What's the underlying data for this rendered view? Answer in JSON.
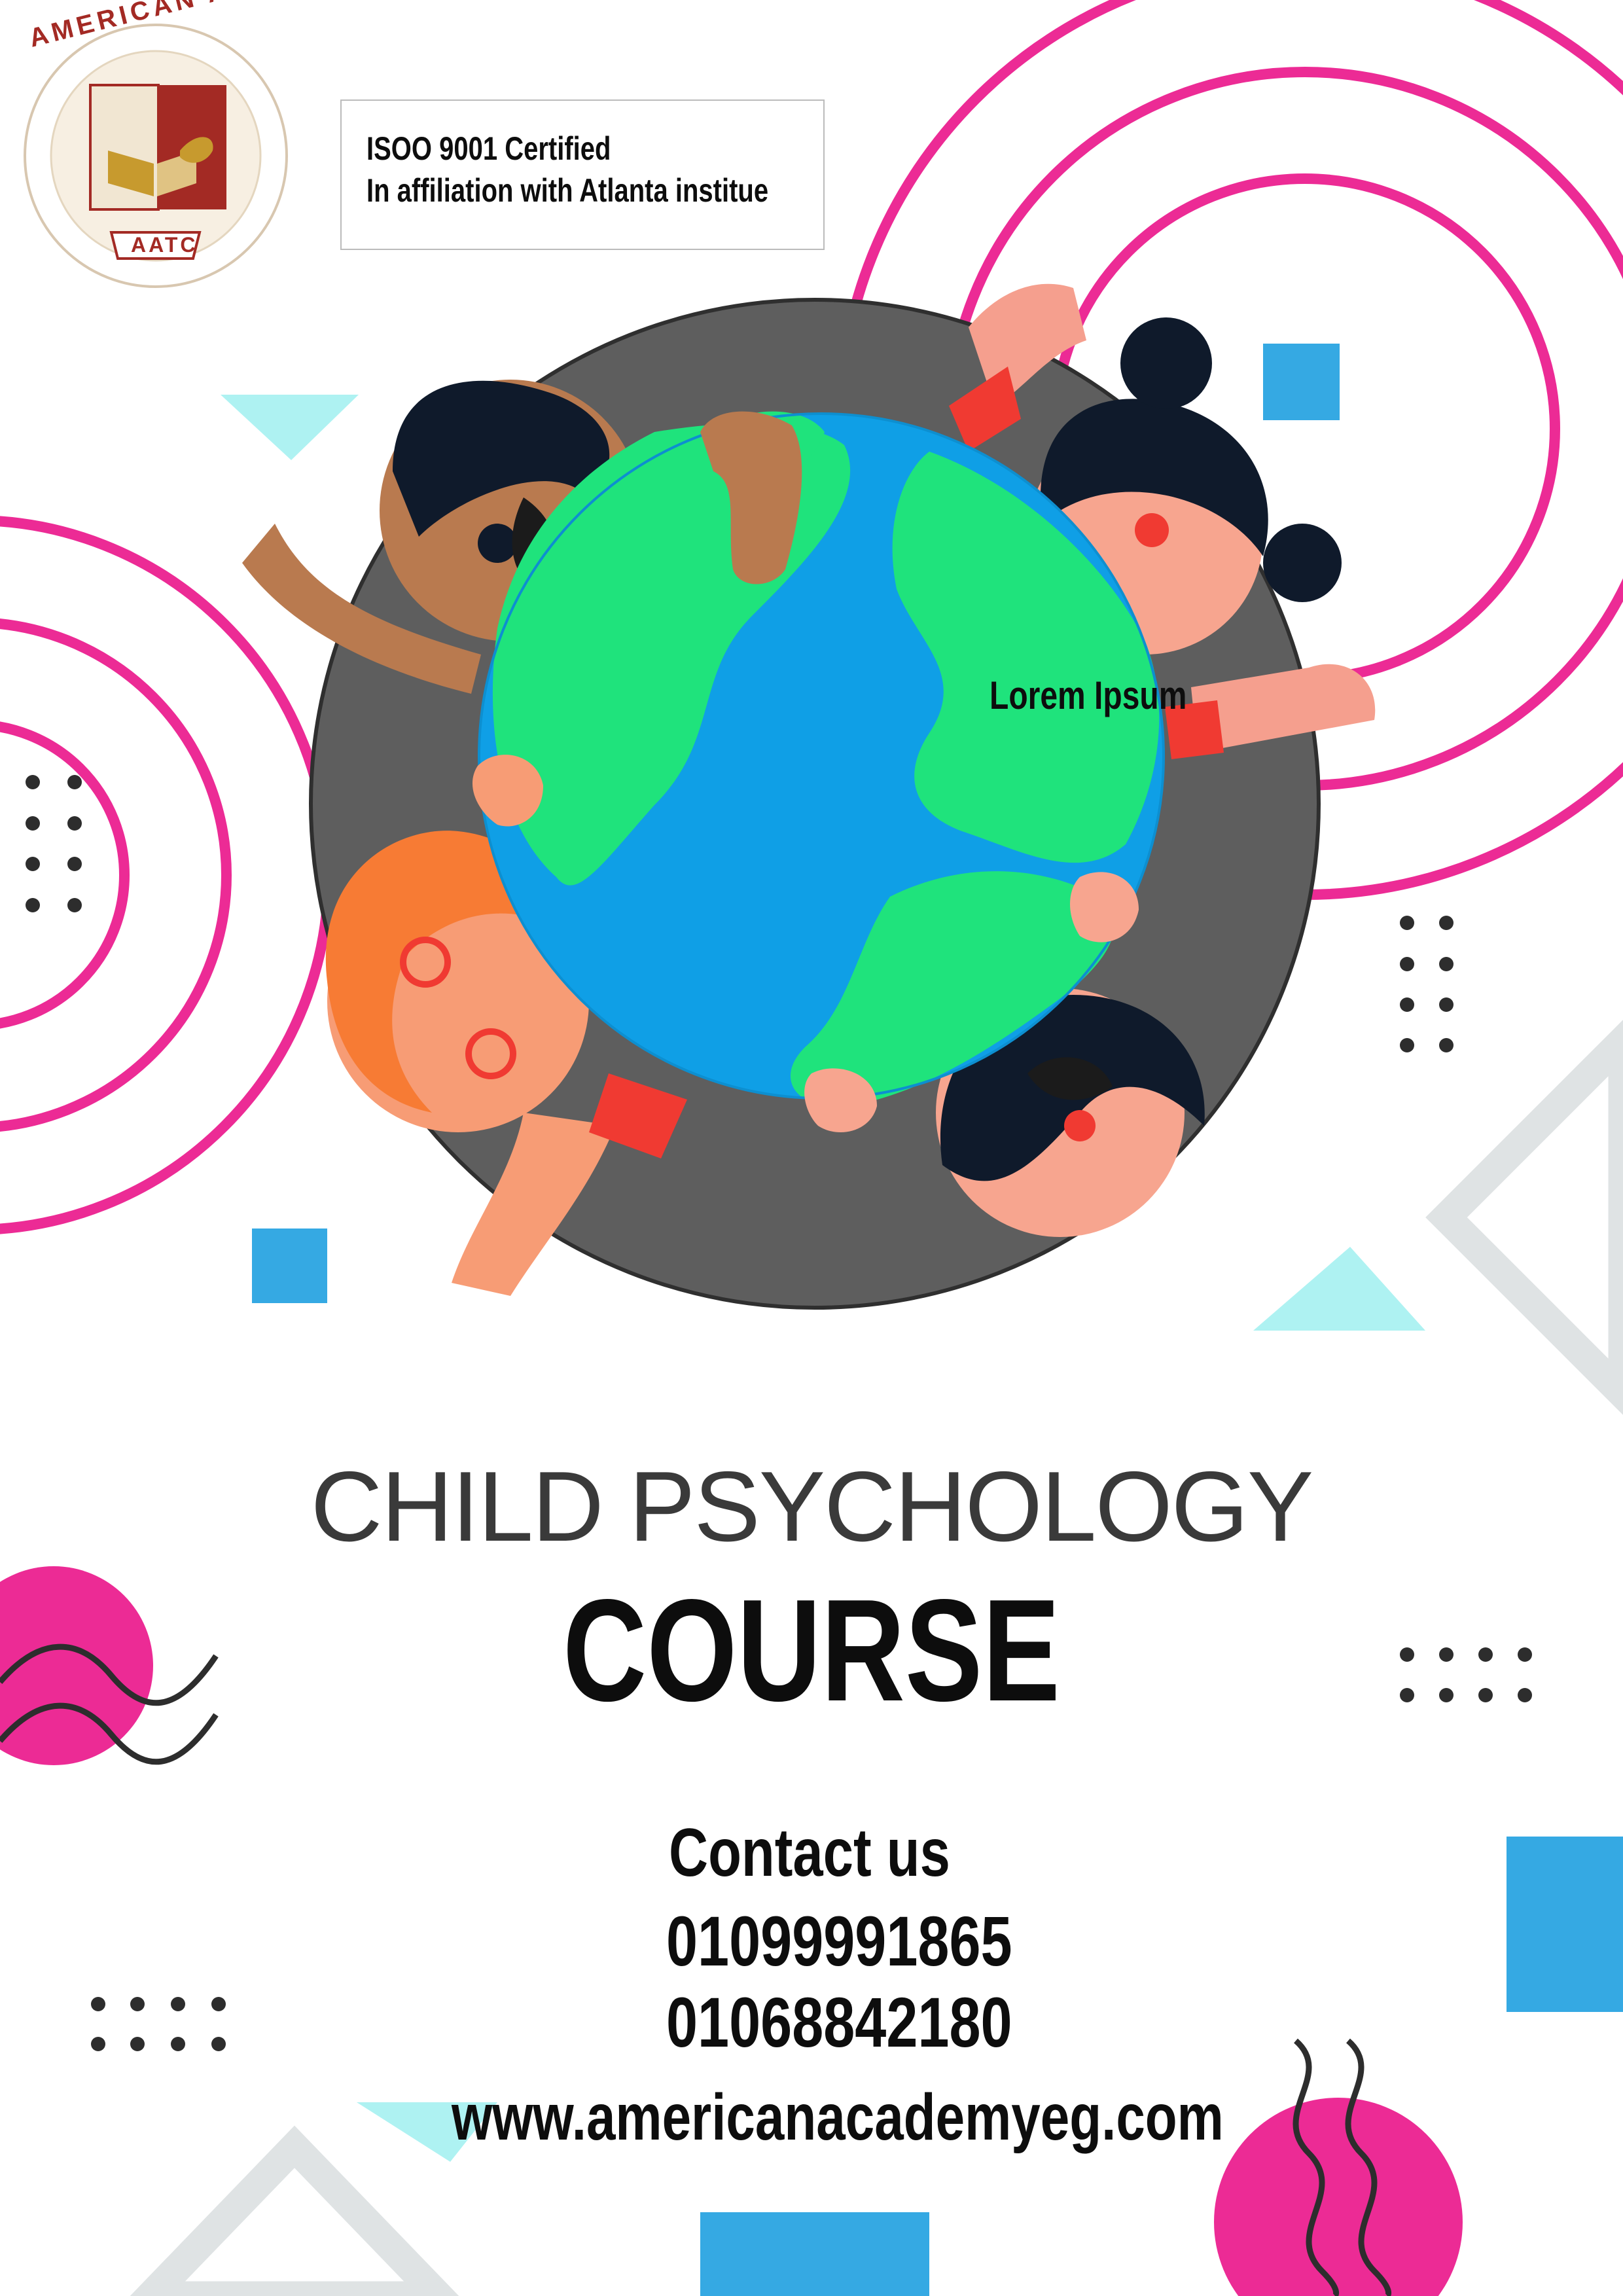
{
  "logo": {
    "arc_text": "AMERICAN ACADEMY",
    "badge_text": "AATC",
    "colors": {
      "maroon": "#a32a24",
      "gold": "#c79a2e",
      "cream": "#f1e6d2"
    }
  },
  "certification": {
    "line1": "ISOO 9001 Certified",
    "line2": "In affiliation with Atlanta institue"
  },
  "illustration": {
    "globe_label": "Lorem Ipsum"
  },
  "title": {
    "line1": "CHILD PSYCHOLOGY",
    "line2": "COURSE"
  },
  "contact": {
    "heading": "Contact us",
    "phone1": "01099991865",
    "phone2": "01068842180",
    "website": "www.americanacademyeg.com"
  },
  "palette": {
    "pink": "#ec2b95",
    "blue": "#35a9e3",
    "cyan": "#aef2f2",
    "grey_ring": "#5e5e5e",
    "globe_green": "#1fe37c",
    "globe_blue": "#0f9fe6",
    "dark_text": "#0d0d0d",
    "title_grey": "#3a3a3a"
  }
}
